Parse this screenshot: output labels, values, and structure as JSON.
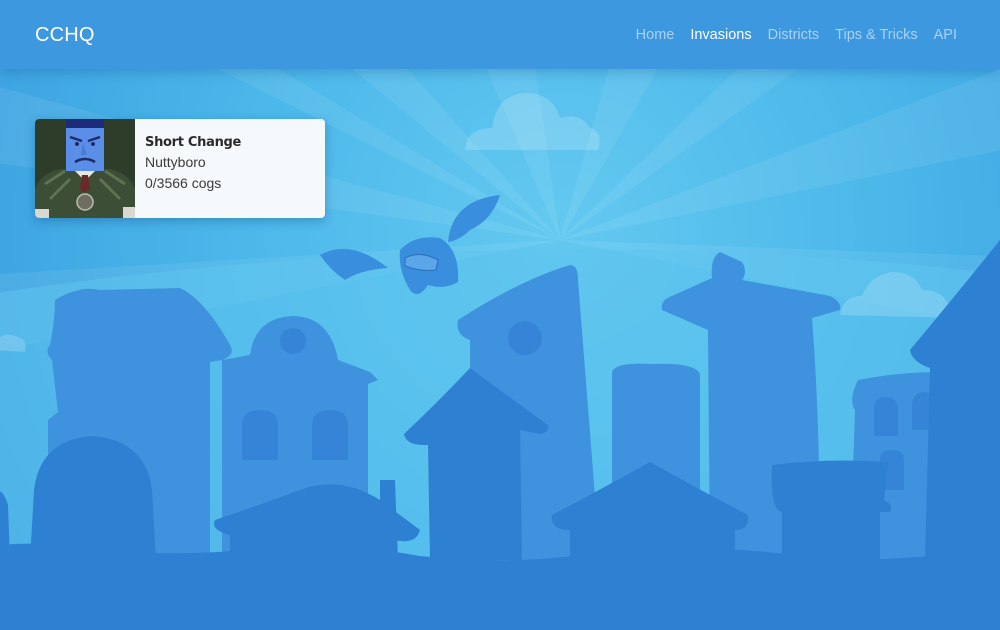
{
  "navbar": {
    "brand": "CCHQ",
    "links": [
      {
        "label": "Home",
        "active": false
      },
      {
        "label": "Invasions",
        "active": true
      },
      {
        "label": "Districts",
        "active": false
      },
      {
        "label": "Tips & Tricks",
        "active": false
      },
      {
        "label": "API",
        "active": false
      }
    ]
  },
  "invasions": [
    {
      "cog": "Short Change",
      "district": "Nuttyboro",
      "progress": "0/3566 cogs",
      "icon": "cog-portrait"
    }
  ],
  "colors": {
    "navbar": "#3d98e0",
    "sky": "#45b3e6",
    "ground": "#2e80d3",
    "nav_active": "#ffffff",
    "nav_inactive": "#a9d2f4"
  }
}
